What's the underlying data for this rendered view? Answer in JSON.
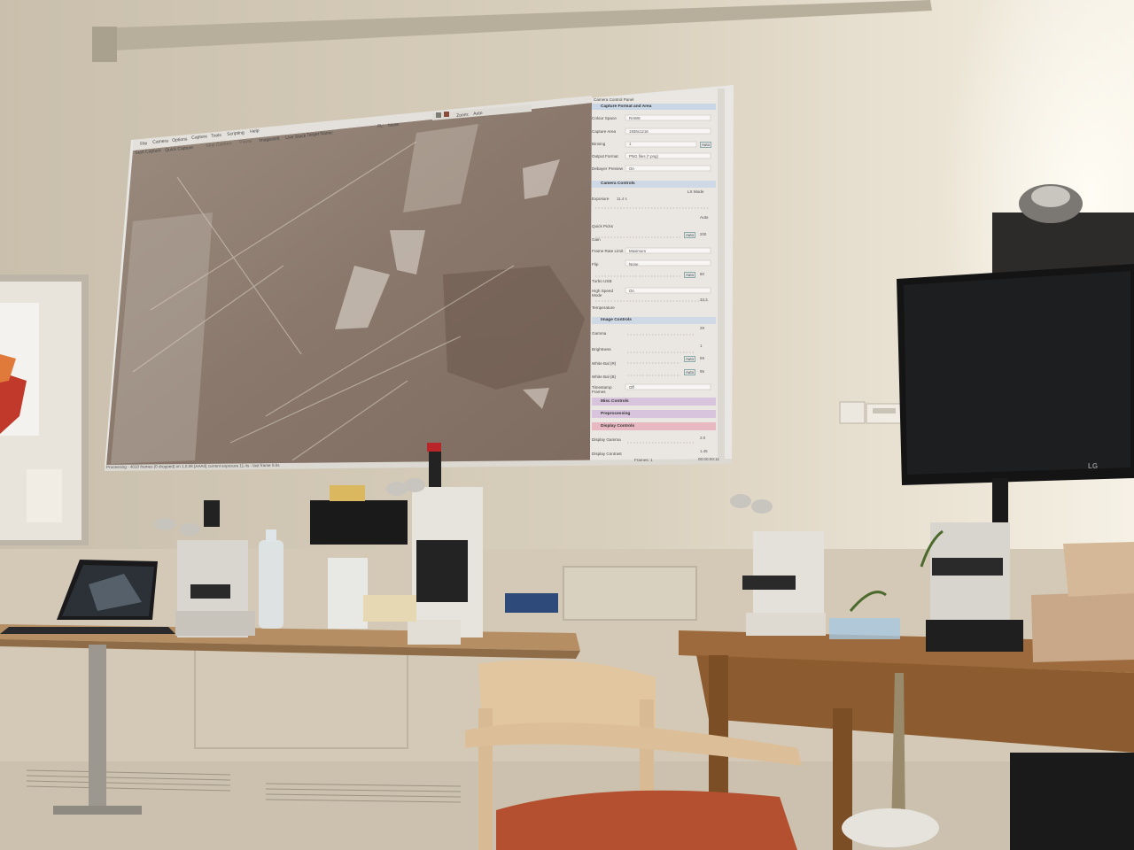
{
  "projection": {
    "menu": [
      "File",
      "Camera",
      "Options",
      "Capture",
      "Tools",
      "Scripting",
      "Help"
    ],
    "toolbar": {
      "start_capture": "Start Capture",
      "quick_capture": "Quick Capture",
      "stop_capture": "Stop Capture",
      "pause": "Pause",
      "imageshift": "Imageshift",
      "live_stack": "Live Stack",
      "target_name": "Target Name:",
      "fl_label": "FL:",
      "fl_value": "None",
      "zoom_label": "Zoom:",
      "zoom_value": "Auto"
    },
    "panel": {
      "title": "Camera Control Panel",
      "sections": {
        "capture_format": "Capture Format and Area",
        "camera_controls": "Camera Controls",
        "image_controls": "Image Controls",
        "misc_controls": "Misc Controls",
        "preprocessing": "Preprocessing",
        "display_controls": "Display Controls"
      },
      "capture_rows": [
        {
          "label": "Colour Space",
          "value": "RAW8"
        },
        {
          "label": "Capture Area",
          "value": "1936x1216"
        },
        {
          "label": "Binning",
          "value": "1",
          "button": "Auto"
        },
        {
          "label": "Output Format",
          "value": "PNG files (*.png)"
        },
        {
          "label": "Debayer Preview",
          "value": "On"
        }
      ],
      "camera_rows": {
        "lx_mode": "LX Mode",
        "exposure_label": "Exposure",
        "exposure_value": "11.4 s",
        "auto_label": "Auto",
        "quick_picks": "Quick Picks",
        "gain": "Gain",
        "gain_button": "Auto",
        "gain_value": "200",
        "frame_rate_label": "Frame Rate Limit",
        "frame_rate_value": "Maximum",
        "flip_label": "Flip",
        "flip_value": "None",
        "turbo_label": "Turbo USB",
        "turbo_button": "Auto",
        "turbo_value": "80",
        "hsm_label": "High Speed Mode",
        "hsm_value": "On",
        "temperature_label": "Temperature",
        "temperature_value": "33.3"
      },
      "image_rows": [
        {
          "label": "Gamma",
          "value": "28"
        },
        {
          "label": "Brightness",
          "value": "1"
        },
        {
          "label": "White Bal (R)",
          "button": "Auto",
          "value": "59"
        },
        {
          "label": "White Bal (B)",
          "button": "Auto",
          "value": "95"
        },
        {
          "label": "Timestamp Frames",
          "value": "Off"
        }
      ],
      "display_rows": [
        {
          "label": "Display Gamma",
          "value": "2.0"
        },
        {
          "label": "Display Contrast",
          "value": "1.45"
        }
      ]
    },
    "status": {
      "left": "Processing - 4010 frames (0 dropped) on 1.0.08 [AAA0] current exposure 11.4s - last frame 0.0s",
      "frames": "Frames: 1",
      "time": "00:00:00:11"
    }
  },
  "scene_objects": {
    "tv_brand": "LG"
  },
  "colors": {
    "wall": "#d7ccb8",
    "panel_bg": "#eae6e2",
    "section_blue": "#cfd9e6",
    "section_purple": "#d8c4dd",
    "section_pink": "#e8b9c0",
    "microscope_image": "#8f7c70"
  }
}
